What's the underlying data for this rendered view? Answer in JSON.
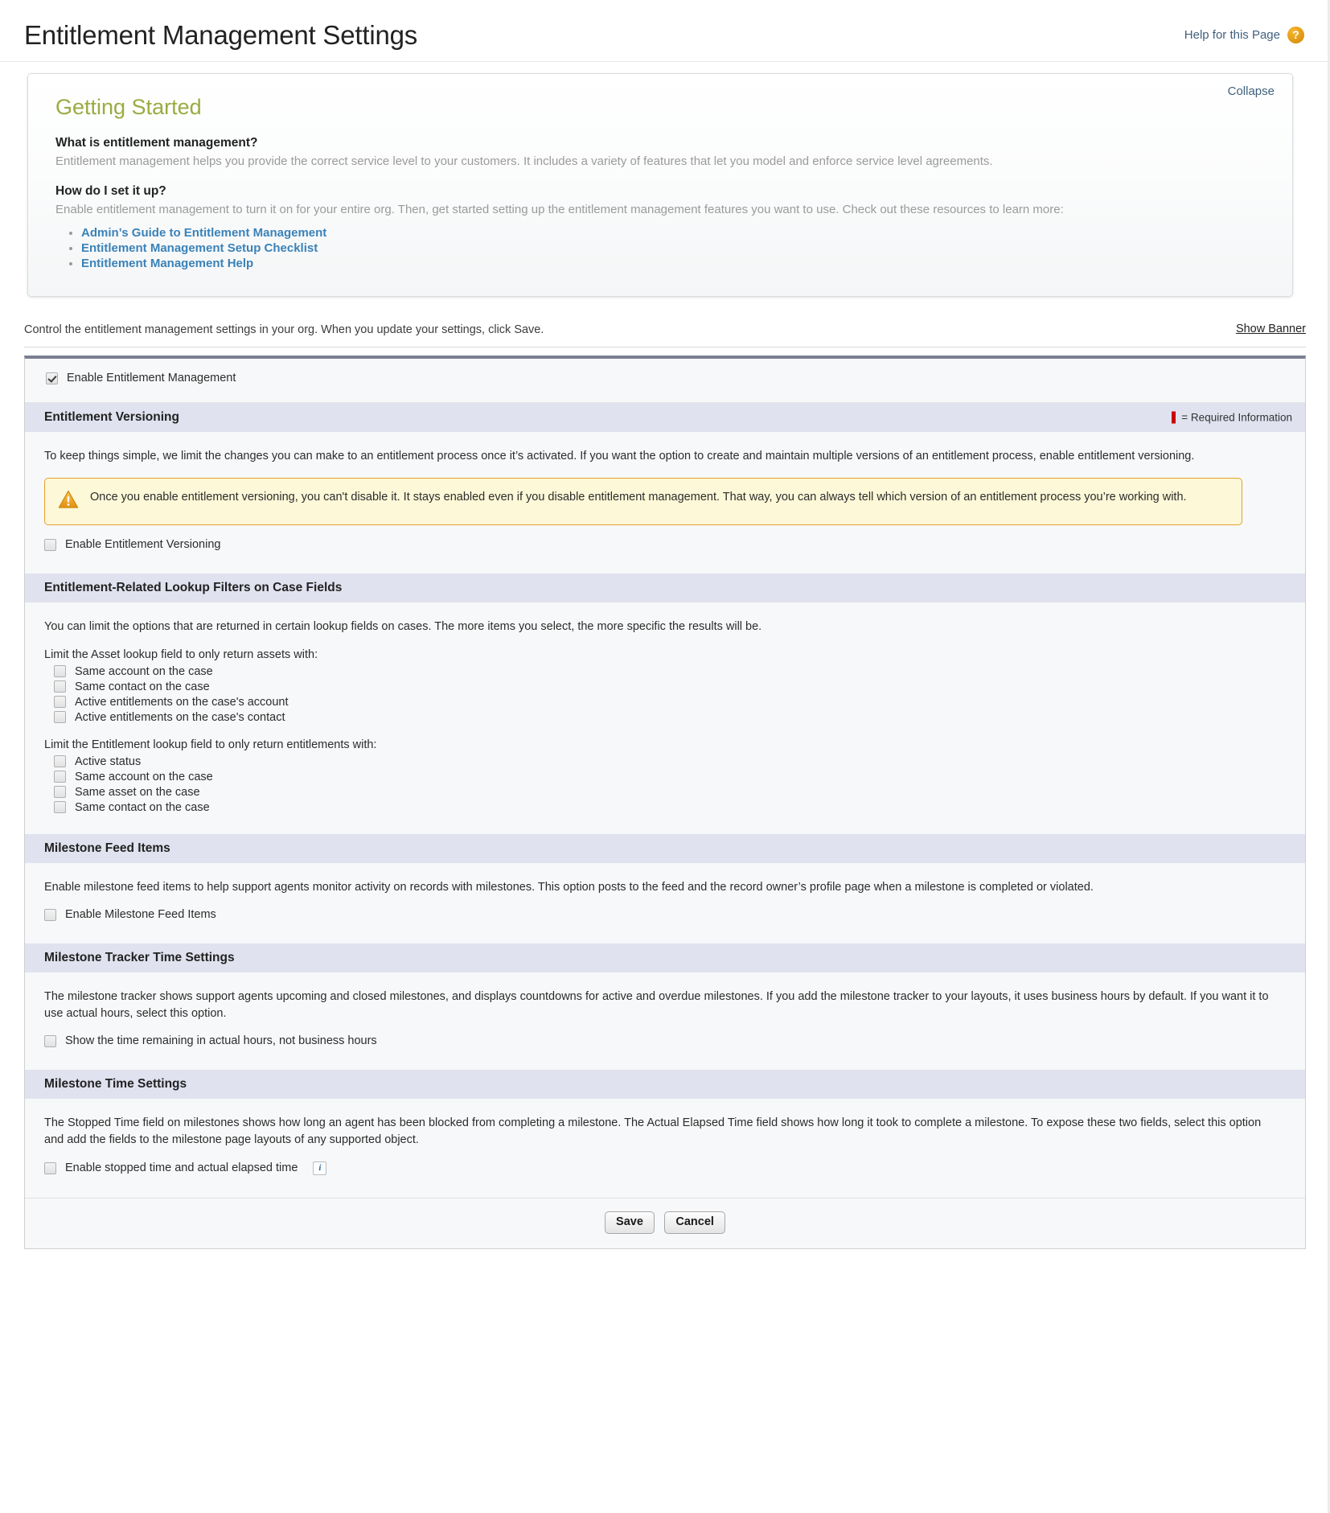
{
  "header": {
    "title": "Entitlement Management Settings",
    "help_label": "Help for this Page",
    "help_icon": "question-mark-icon"
  },
  "getting_started": {
    "collapse_label": "Collapse",
    "title": "Getting Started",
    "q1": "What is entitlement management?",
    "a1": "Entitlement management helps you provide the correct service level to your customers. It includes a variety of features that let you model and enforce service level agreements.",
    "q2": "How do I set it up?",
    "a2": "Enable entitlement management to turn it on for your entire org. Then, get started setting up the entitlement management features you want to use. Check out these resources to learn more:",
    "links": [
      "Admin’s Guide to Entitlement Management",
      "Entitlement Management Setup Checklist",
      "Entitlement Management Help"
    ]
  },
  "control_bar": {
    "text": "Control the entitlement management settings in your org. When you update your settings, click Save.",
    "show_banner_label": "Show Banner"
  },
  "form": {
    "enable_entitlement_management": {
      "label": "Enable Entitlement Management",
      "checked": true
    },
    "required_legend": "= Required Information",
    "sections": [
      {
        "title": "Entitlement Versioning",
        "desc": "To keep things simple, we limit the changes you can make to an entitlement process once it’s activated. If you want the option to create and maintain multiple versions of an entitlement process, enable entitlement versioning.",
        "warning": "Once you enable entitlement versioning, you can't disable it. It stays enabled even if you disable entitlement management. That way, you can always tell which version of an entitlement process you’re working with.",
        "checkbox": "Enable Entitlement Versioning"
      },
      {
        "title": "Entitlement-Related Lookup Filters on Case Fields",
        "desc": "You can limit the options that are returned in certain lookup fields on cases. The more items you select, the more specific the results will be.",
        "group1_label": "Limit the Asset lookup field to only return assets with:",
        "group1_items": [
          "Same account on the case",
          "Same contact on the case",
          "Active entitlements on the case's account",
          "Active entitlements on the case's contact"
        ],
        "group2_label": "Limit the Entitlement lookup field to only return entitlements with:",
        "group2_items": [
          "Active status",
          "Same account on the case",
          "Same asset on the case",
          "Same contact on the case"
        ]
      },
      {
        "title": "Milestone Feed Items",
        "desc": "Enable milestone feed items to help support agents monitor activity on records with milestones. This option posts to the feed and the record owner’s profile page when a milestone is completed or violated.",
        "checkbox": "Enable Milestone Feed Items"
      },
      {
        "title": "Milestone Tracker Time Settings",
        "desc": "The milestone tracker shows support agents upcoming and closed milestones, and displays countdowns for active and overdue milestones. If you add the milestone tracker to your layouts, it uses business hours by default. If you want it to use actual hours, select this option.",
        "checkbox": "Show the time remaining in actual hours, not business hours"
      },
      {
        "title": "Milestone Time Settings",
        "desc": "The Stopped Time field on milestones shows how long an agent has been blocked from completing a milestone. The Actual Elapsed Time field shows how long it took to complete a milestone. To expose these two fields, select this option and add the fields to the milestone page layouts of any supported object.",
        "checkbox": "Enable stopped time and actual elapsed time"
      }
    ],
    "save_label": "Save",
    "cancel_label": "Cancel"
  },
  "colors": {
    "accent_green": "#9aab41",
    "link_blue": "#3a82b8",
    "section_header_bg": "#e0e2ef",
    "warning_bg": "#fdf8d7",
    "warning_border": "#e3a12c",
    "required_red": "#cc0000",
    "top_rule": "#7a7f93"
  }
}
